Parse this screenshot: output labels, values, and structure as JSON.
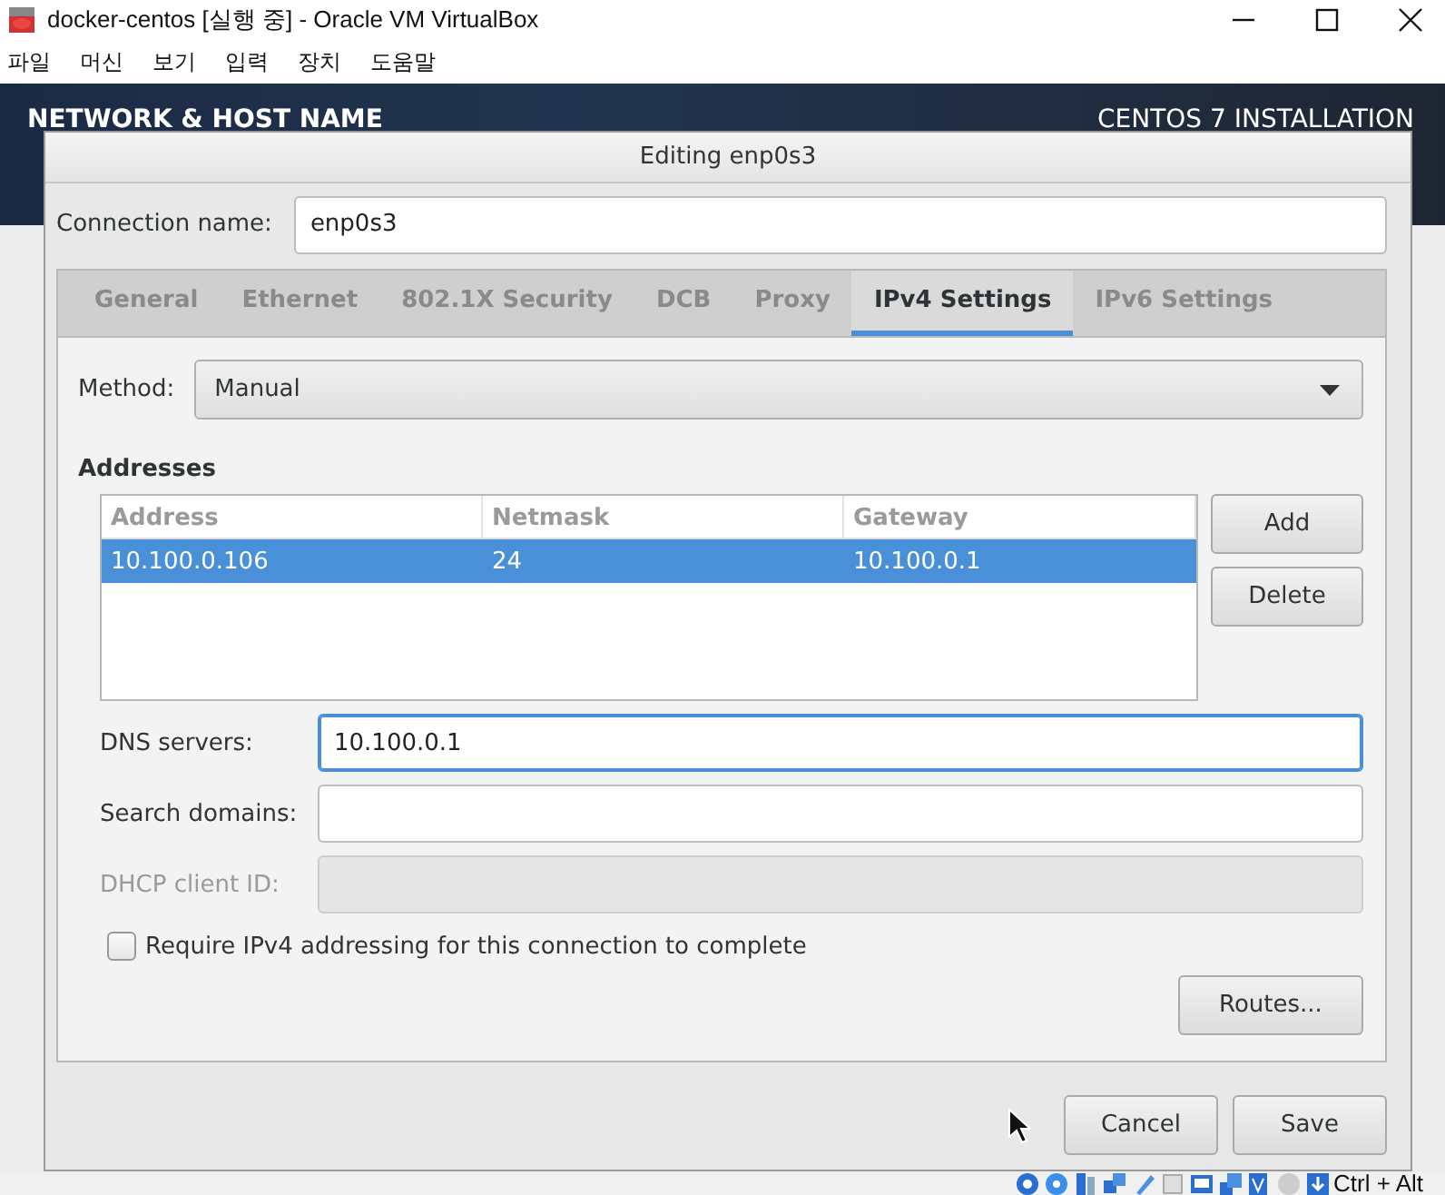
{
  "window": {
    "title": "docker-centos [실행 중] - Oracle VM VirtualBox"
  },
  "menu": [
    "파일",
    "머신",
    "보기",
    "입력",
    "장치",
    "도움말"
  ],
  "installer": {
    "heading": "NETWORK & HOST NAME",
    "product": "CENTOS 7 INSTALLATION"
  },
  "dialog": {
    "title": "Editing enp0s3",
    "connection_name": {
      "label": "Connection name:",
      "value": "enp0s3"
    },
    "tabs": [
      {
        "label": "General",
        "selected": false
      },
      {
        "label": "Ethernet",
        "selected": false
      },
      {
        "label": "802.1X Security",
        "selected": false
      },
      {
        "label": "DCB",
        "selected": false
      },
      {
        "label": "Proxy",
        "selected": false
      },
      {
        "label": "IPv4 Settings",
        "selected": true
      },
      {
        "label": "IPv6 Settings",
        "selected": false
      }
    ],
    "method": {
      "label": "Method:",
      "value": "Manual"
    },
    "addresses": {
      "heading": "Addresses",
      "columns": [
        "Address",
        "Netmask",
        "Gateway"
      ],
      "rows": [
        {
          "cells": [
            "10.100.0.106",
            "24",
            "10.100.0.1"
          ],
          "selected": true
        }
      ],
      "buttons": [
        "Add",
        "Delete"
      ]
    },
    "fields": [
      {
        "label": "DNS servers:",
        "value": "10.100.0.1",
        "focused": true,
        "disabled": false
      },
      {
        "label": "Search domains:",
        "focused": false,
        "disabled": false
      },
      {
        "label": "DHCP client ID:",
        "focused": false,
        "disabled": true
      }
    ],
    "require_checkbox": {
      "label": "Require IPv4 addressing for this connection to complete",
      "checked": false
    },
    "routes_button": "Routes...",
    "buttons": [
      "Cancel",
      "Save"
    ]
  },
  "status_bar": {
    "host_key": "Ctrl + Alt"
  }
}
